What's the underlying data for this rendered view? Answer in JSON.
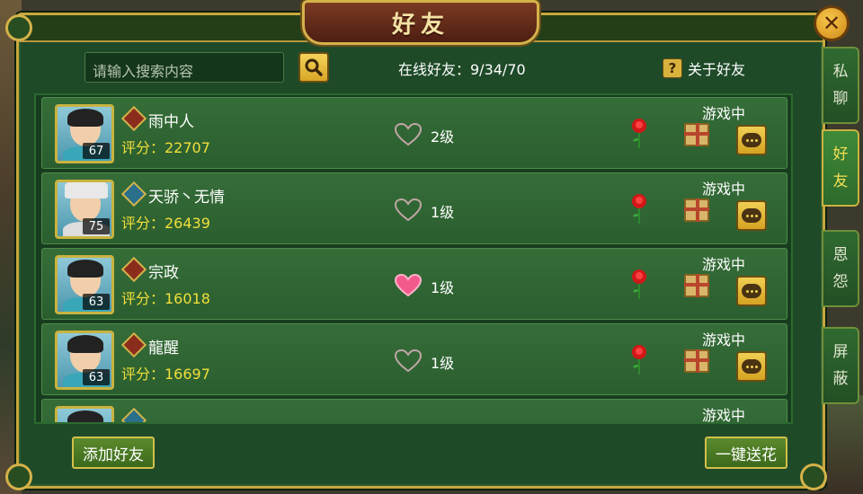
{
  "window": {
    "title": "好友",
    "close_icon": "close-x-icon"
  },
  "search": {
    "placeholder": "请输入搜索内容",
    "icon": "search-icon"
  },
  "online_label": "在线好友：9/34/70",
  "about_label": "关于好友",
  "friends": [
    {
      "name": "雨中人",
      "level": "67",
      "score_label": "评分：22707",
      "intimacy": "2级",
      "heart_filled": false,
      "status": "游戏中",
      "class_color": "red"
    },
    {
      "name": "天骄丶无情",
      "level": "75",
      "score_label": "评分：26439",
      "intimacy": "1级",
      "heart_filled": false,
      "status": "游戏中",
      "class_color": "blue"
    },
    {
      "name": "宗政",
      "level": "63",
      "score_label": "评分：16018",
      "intimacy": "1级",
      "heart_filled": true,
      "status": "游戏中",
      "class_color": "red"
    },
    {
      "name": "龍醒",
      "level": "63",
      "score_label": "评分：16697",
      "intimacy": "1级",
      "heart_filled": false,
      "status": "游戏中",
      "class_color": "red"
    },
    {
      "status": "游戏中"
    }
  ],
  "side_tabs": [
    {
      "label_1": "私",
      "label_2": "聊",
      "active": false
    },
    {
      "label_1": "好",
      "label_2": "友",
      "active": true
    },
    {
      "label_1": "恩",
      "label_2": "怨",
      "active": false
    },
    {
      "label_1": "屏",
      "label_2": "蔽",
      "active": false
    }
  ],
  "footer": {
    "add_friend": "添加好友",
    "send_flowers": "一键送花"
  },
  "colors": {
    "panel": "#1e4a28",
    "gold": "#c7a73d",
    "score": "#f3df3a",
    "heart_filled": "#f25a8c"
  }
}
